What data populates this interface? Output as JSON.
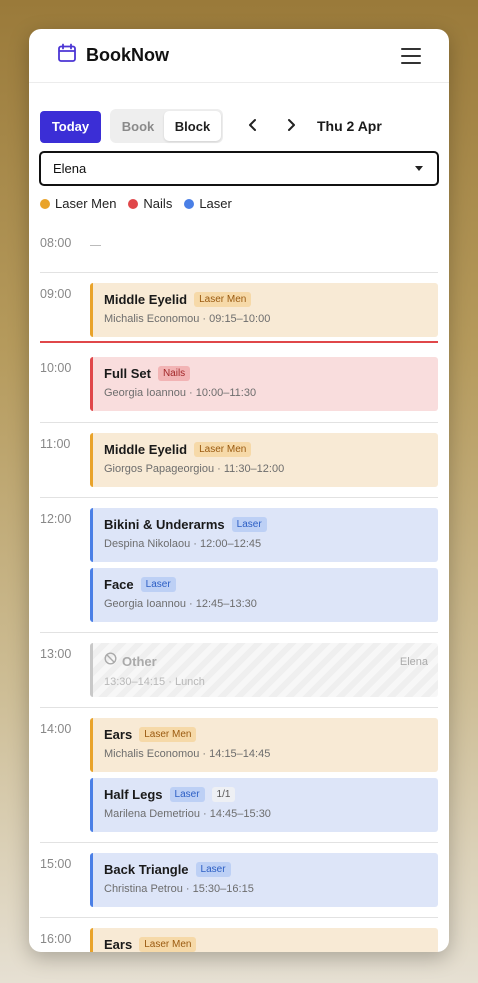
{
  "app": {
    "name": "BookNow",
    "logo_icon": "calendar-icon",
    "menu_icon": "hamburger-icon"
  },
  "toolbar": {
    "today_label": "Today",
    "mode_book": "Book",
    "mode_block": "Block",
    "prev_icon": "‹",
    "next_icon": "›",
    "date": "Thu 2 Apr"
  },
  "staff_select": {
    "value": "Elena"
  },
  "legend": [
    {
      "label": "Laser Men",
      "color": "#e9a32a"
    },
    {
      "label": "Nails",
      "color": "#e0474a"
    },
    {
      "label": "Laser",
      "color": "#4a7fe6"
    }
  ],
  "hours": [
    "08:00",
    "09:00",
    "10:00",
    "11:00",
    "12:00",
    "13:00",
    "14:00",
    "15:00",
    "16:00"
  ],
  "empty_marker": "—",
  "appointments": [
    {
      "title": "Middle Eyelid",
      "badge": "Laser Men",
      "sub": "Michalis Economou · 09:15–10:00"
    },
    {
      "title": "Full Set",
      "badge": "Nails",
      "sub": "Georgia Ioannou · 10:00–11:30"
    },
    {
      "title": "Middle Eyelid",
      "badge": "Laser Men",
      "sub": "Giorgos Papageorgiou · 11:30–12:00"
    },
    {
      "title": "Bikini & Underarms",
      "badge": "Laser",
      "sub": "Despina Nikolaou · 12:00–12:45"
    },
    {
      "title": "Face",
      "badge": "Laser",
      "sub": "Georgia Ioannou · 12:45–13:30"
    },
    {
      "title": "Ears",
      "badge": "Laser Men",
      "sub": "Michalis Economou · 14:15–14:45"
    },
    {
      "title": "Half Legs",
      "badge": "Laser",
      "count": "1/1",
      "sub": "Marilena Demetriou · 14:45–15:30"
    },
    {
      "title": "Back Triangle",
      "badge": "Laser",
      "sub": "Christina Petrou · 15:30–16:15"
    },
    {
      "title": "Ears",
      "badge": "Laser Men"
    }
  ],
  "block": {
    "title": "Other",
    "staff": "Elena",
    "sub": "13:30–14:15 · Lunch",
    "icon": "blocked-icon"
  }
}
